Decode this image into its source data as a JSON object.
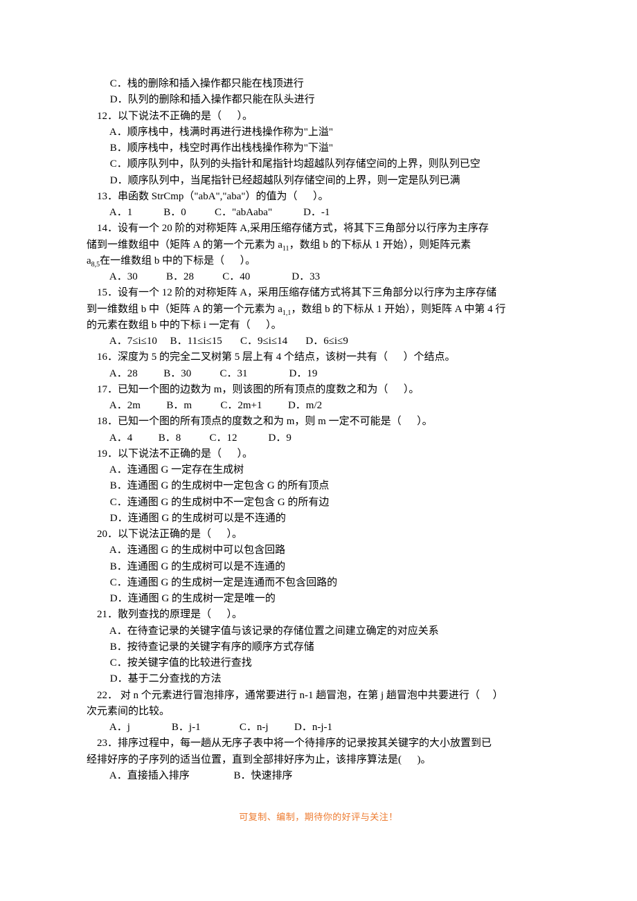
{
  "lines": [
    "         C．栈的删除和插入操作都只能在栈顶进行",
    "         D．队列的删除和插入操作都只能在队头进行",
    "    12．以下说法不正确的是（      ）。",
    "         A．顺序栈中，栈满时再进行进栈操作称为\"上溢\"",
    "         B．顺序栈中，栈空时再作出栈栈操作称为\"下溢\"",
    "         C．顺序队列中，队列的头指针和尾指针均超越队列存储空间的上界，则队列已空",
    "         D．顺序队列中，当尾指针已经超越队列存储空间的上界，则一定是队列已满",
    "    13．串函数 StrCmp（\"abA\",\"aba\"）的值为（      ）。",
    "         A．1            B．0           C．\"abAaba\"            D．-1",
    {
      "type": "mixed",
      "parts": [
        "    14．设有一个 20 阶的对称矩阵 A,采用压缩存储方式，将其下三角部分以行序为主序存",
        "储到一维数组中（矩阵 A 的第一个元素为 a",
        [
          "sub",
          "11"
        ],
        "，数组 b 的下标从 1 开始），则矩阵元素",
        "a",
        [
          "sub",
          "8,5"
        ],
        "在一维数组 b 中的下标是（      ）。"
      ]
    },
    "         A．30           B．28           C．40                D．33",
    {
      "type": "mixed",
      "parts": [
        "    15．设有一个 12 阶的对称矩阵 A，采用压缩存储方式将其下三角部分以行序为主序存储",
        "到一维数组 b 中（矩阵 A 的第一个元素为 a",
        [
          "sub",
          "1,1"
        ],
        "，数组 b 的下标从 1 开始），则矩阵 A 中第 4 行",
        "的元素在数组 b 中的下标 i 一定有（      ）。"
      ]
    },
    "         A．7≤i≤10     B．11≤i≤15       C．9≤i≤14       D．6≤i≤9",
    "    16．深度为 5 的完全二叉树第 5 层上有 4 个结点，该树一共有（      ）个结点。",
    "         A．28          B．30           C．31                D．19",
    "    17．已知一个图的边数为 m，则该图的所有顶点的度数之和为（      ）。",
    "         A．2m          B．m           C．2m+1          D．m/2",
    "    18．已知一个图的所有顶点的度数之和为 m，则 m 一定不可能是（      ）。",
    "         A．4          B．8           C．12            D．9",
    "    19．以下说法不正确的是（      ）。",
    "         A．连通图 G 一定存在生成树",
    "         B．连通图 G 的生成树中一定包含 G 的所有顶点",
    "         C．连通图 G 的生成树中不一定包含 G 的所有边",
    "         D．连通图 G 的生成树可以是不连通的",
    "    20．以下说法正确的是（      ）。",
    "         A．连通图 G 的生成树中可以包含回路",
    "         B．连通图 G 的生成树可以是不连通的",
    "         C．连通图 G 的生成树一定是连通而不包含回路的",
    "         D．连通图 G 的生成树一定是唯一的",
    "    21．散列查找的原理是（      ）。",
    "         A．在待查记录的关键字值与该记录的存储位置之间建立确定的对应关系",
    "         B．按待查记录的关键字有序的顺序方式存储",
    "         C．按关键字值的比较进行查找",
    "         D．基于二分查找的方法",
    "    22． 对 n 个元素进行冒泡排序，通常要进行 n-1 趟冒泡，在第 j 趟冒泡中共要进行（     ）",
    "次元素间的比较。",
    "         A．j                B．j-1               C．n-j          D．n-j-1",
    "    23．排序过程中，每一趟从无序子表中将一个待排序的记录按其关键字的大小放置到已",
    "经排好序的子序列的适当位置，直到全部排好序为止，该排序算法是(      )。",
    "         A．直接插入排序                 B．快速排序"
  ],
  "multi14": {
    "l1": "    14．设有一个 20 阶的对称矩阵 A,采用压缩存储方式，将其下三角部分以行序为主序存",
    "l2a": "储到一维数组中（矩阵 A 的第一个元素为 a",
    "l2sub": "11",
    "l2b": "，数组 b 的下标从 1 开始），则矩阵元素",
    "l3a": "a",
    "l3sub": "8,5",
    "l3b": "在一维数组 b 中的下标是（      ）。"
  },
  "multi15": {
    "l1": "    15．设有一个 12 阶的对称矩阵 A，采用压缩存储方式将其下三角部分以行序为主序存储",
    "l2a": "到一维数组 b 中（矩阵 A 的第一个元素为 a",
    "l2sub": "1,1",
    "l2b": "，数组 b 的下标从 1 开始），则矩阵 A 中第 4 行",
    "l3": "的元素在数组 b 中的下标 i 一定有（      ）。"
  },
  "footer": "可复制、编制，期待你的好评与关注！"
}
